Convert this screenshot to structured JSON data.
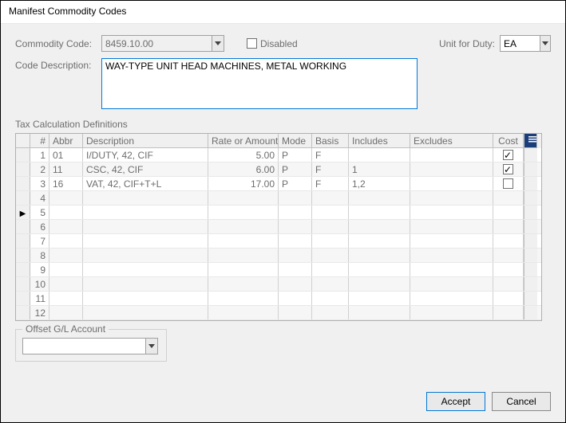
{
  "title": "Manifest Commodity Codes",
  "labels": {
    "commodity_code": "Commodity Code:",
    "disabled": "Disabled",
    "unit_for_duty": "Unit for Duty:",
    "code_description": "Code Description:",
    "tax_section": "Tax Calculation Definitions",
    "offset_section": "Offset G/L Account"
  },
  "fields": {
    "commodity_code": "8459.10.00",
    "disabled_checked": false,
    "unit_for_duty": "EA",
    "code_description": "WAY-TYPE UNIT HEAD MACHINES, METAL WORKING",
    "offset_account": ""
  },
  "grid": {
    "headers": {
      "num": "#",
      "abbr": "Abbr",
      "desc": "Description",
      "rate": "Rate or Amount",
      "mode": "Mode",
      "basis": "Basis",
      "incl": "Includes",
      "excl": "Excludes",
      "cost": "Cost"
    },
    "rows": [
      {
        "num": "1",
        "abbr": "01",
        "desc": "I/DUTY, 42, CIF",
        "rate": "5.00",
        "mode": "P",
        "basis": "F",
        "incl": "",
        "excl": "",
        "cost": true
      },
      {
        "num": "2",
        "abbr": "11",
        "desc": "CSC, 42, CIF",
        "rate": "6.00",
        "mode": "P",
        "basis": "F",
        "incl": "1",
        "excl": "",
        "cost": true
      },
      {
        "num": "3",
        "abbr": "16",
        "desc": "VAT, 42, CIF+T+L",
        "rate": "17.00",
        "mode": "P",
        "basis": "F",
        "incl": "1,2",
        "excl": "",
        "cost": false
      },
      {
        "num": "4"
      },
      {
        "num": "5",
        "pointer": true
      },
      {
        "num": "6"
      },
      {
        "num": "7"
      },
      {
        "num": "8"
      },
      {
        "num": "9"
      },
      {
        "num": "10"
      },
      {
        "num": "11"
      },
      {
        "num": "12"
      }
    ]
  },
  "buttons": {
    "accept": "Accept",
    "cancel": "Cancel"
  }
}
